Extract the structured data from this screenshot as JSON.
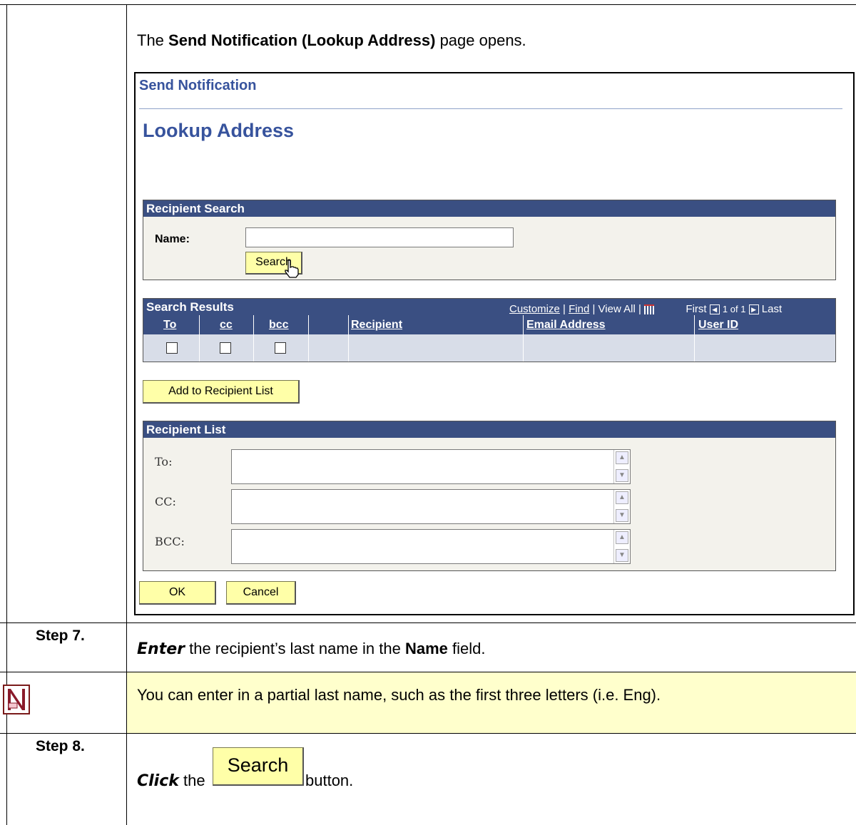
{
  "intro": {
    "pre": "The ",
    "bold": "Send Notification (Lookup Address)",
    "post": " page opens."
  },
  "screen": {
    "title": "Send Notification",
    "heading": "Lookup Address",
    "recipient_search": {
      "header": "Recipient Search",
      "name_label": "Name:",
      "name_value": "",
      "search_button": "Search"
    },
    "search_results": {
      "header": "Search Results",
      "customize": "Customize",
      "find": "Find",
      "view_all": "View All",
      "first": "First",
      "count": "1 of 1",
      "last": "Last",
      "columns": [
        "To",
        "cc",
        "bcc",
        "",
        "Recipient",
        "Email Address",
        "User ID"
      ]
    },
    "add_button": "Add to Recipient List",
    "recipient_list": {
      "header": "Recipient List",
      "to_label": "To:",
      "cc_label": "CC:",
      "bcc_label": "BCC:"
    },
    "ok_button": "OK",
    "cancel_button": "Cancel"
  },
  "step7": {
    "label": "Step 7.",
    "action": "Enter",
    "pre": " the recipient’s last name in the ",
    "bold": "Name",
    "post": " field."
  },
  "note": {
    "text": "You can enter in a partial last name, such as the first three letters (i.e. Eng).",
    "icon": "note-icon"
  },
  "step8": {
    "label": "Step 8.",
    "action": "Click",
    "pre": " the ",
    "button": "Search",
    "post": " button."
  }
}
